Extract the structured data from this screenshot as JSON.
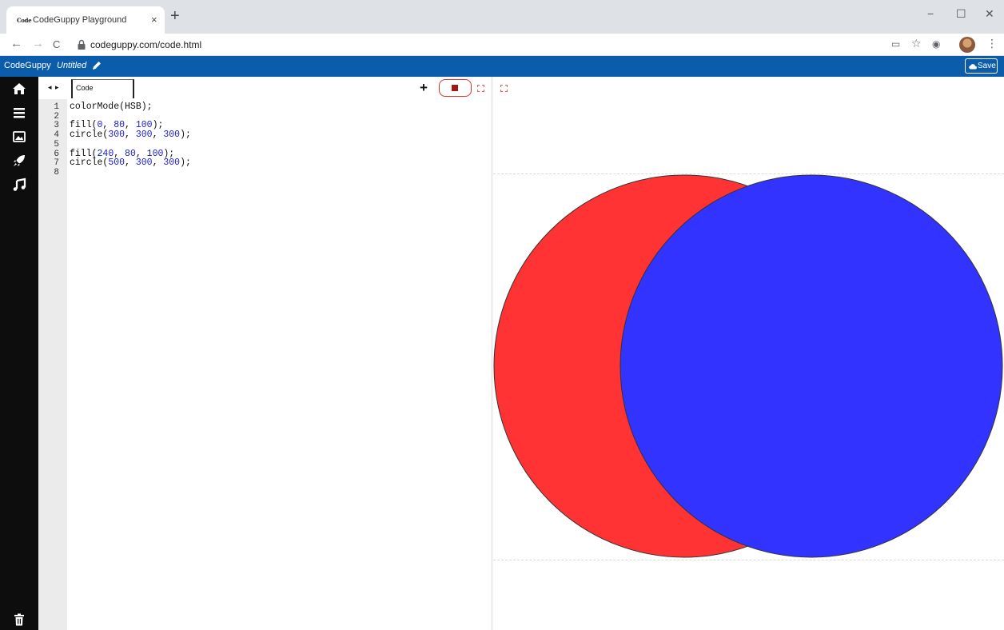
{
  "browser": {
    "tab_favicon_text": "Code",
    "tab_title": "CodeGuppy Playground",
    "tab_close": "×",
    "new_tab": "+",
    "url": "codeguppy.com/code.html",
    "window": {
      "minimize": "−",
      "maximize": "☐",
      "close": "✕"
    },
    "nav": {
      "back": "←",
      "forward": "→",
      "reload": "C"
    },
    "toolbar_icons": {
      "cast": "▭",
      "bookmark": "☆",
      "extension": "◉",
      "menu": "⋮"
    }
  },
  "app": {
    "brand": "CodeGuppy",
    "project_name": "Untitled",
    "save_label": "Save",
    "colors": {
      "header": "#0b5cab",
      "sidebar": "#0d0d0d",
      "stop_border": "#e03030"
    }
  },
  "sidebar": {
    "items": [
      {
        "icon": "home-icon"
      },
      {
        "icon": "list-icon"
      },
      {
        "icon": "image-icon"
      },
      {
        "icon": "rocket-icon"
      },
      {
        "icon": "music-icon"
      }
    ],
    "bottom": {
      "icon": "trash-icon"
    }
  },
  "editor": {
    "arrows": "◂ ▸",
    "tab_label": "Code",
    "add_label": "+",
    "lines": [
      {
        "n": "1",
        "text": "colorMode(HSB);"
      },
      {
        "n": "2",
        "text": ""
      },
      {
        "n": "3",
        "text": "fill(0, 80, 100);"
      },
      {
        "n": "4",
        "text": "circle(300, 300, 300);"
      },
      {
        "n": "5",
        "text": ""
      },
      {
        "n": "6",
        "text": "fill(240, 80, 100);"
      },
      {
        "n": "7",
        "text": "circle(500, 300, 300);"
      },
      {
        "n": "8",
        "text": ""
      }
    ],
    "active_line": "8"
  },
  "output": {
    "circles": [
      {
        "fill": "#ff3333",
        "stroke": "#333333"
      },
      {
        "fill": "#3333ff",
        "stroke": "#333333"
      }
    ]
  }
}
